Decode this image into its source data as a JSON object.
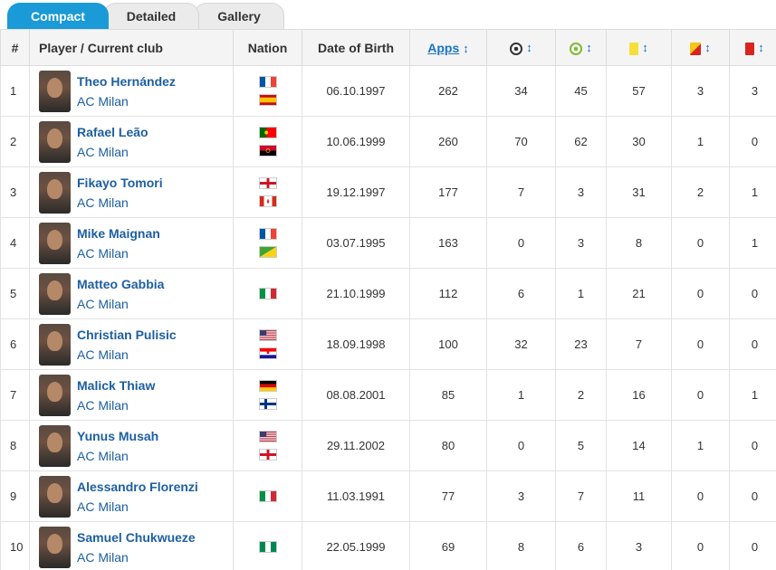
{
  "tabs": [
    "Compact",
    "Detailed",
    "Gallery"
  ],
  "headers": {
    "num": "#",
    "player": "Player / Current club",
    "nation": "Nation",
    "dob": "Date of Birth",
    "apps": "Apps",
    "sort_arrow": "↕"
  },
  "header_icons": [
    "goals-icon",
    "assists-icon",
    "yellow-card-icon",
    "second-yellow-card-icon",
    "red-card-icon"
  ],
  "colors": {
    "accent": "#1a9ad6",
    "link": "#1d5fa1"
  },
  "rows": [
    {
      "num": "1",
      "name": "Theo Hernández",
      "club": "AC Milan",
      "flags": [
        "france",
        "spain"
      ],
      "dob": "06.10.1997",
      "apps": "262",
      "goals": "34",
      "assists": "45",
      "yellow": "57",
      "second_yellow": "3",
      "red": "3"
    },
    {
      "num": "2",
      "name": "Rafael Leão",
      "club": "AC Milan",
      "flags": [
        "portugal",
        "angola"
      ],
      "dob": "10.06.1999",
      "apps": "260",
      "goals": "70",
      "assists": "62",
      "yellow": "30",
      "second_yellow": "1",
      "red": "0"
    },
    {
      "num": "3",
      "name": "Fikayo Tomori",
      "club": "AC Milan",
      "flags": [
        "england",
        "canada"
      ],
      "dob": "19.12.1997",
      "apps": "177",
      "goals": "7",
      "assists": "3",
      "yellow": "31",
      "second_yellow": "2",
      "red": "1"
    },
    {
      "num": "4",
      "name": "Mike Maignan",
      "club": "AC Milan",
      "flags": [
        "france",
        "french-guiana"
      ],
      "dob": "03.07.1995",
      "apps": "163",
      "goals": "0",
      "assists": "3",
      "yellow": "8",
      "second_yellow": "0",
      "red": "1"
    },
    {
      "num": "5",
      "name": "Matteo Gabbia",
      "club": "AC Milan",
      "flags": [
        "italy"
      ],
      "dob": "21.10.1999",
      "apps": "112",
      "goals": "6",
      "assists": "1",
      "yellow": "21",
      "second_yellow": "0",
      "red": "0"
    },
    {
      "num": "6",
      "name": "Christian Pulisic",
      "club": "AC Milan",
      "flags": [
        "usa",
        "croatia"
      ],
      "dob": "18.09.1998",
      "apps": "100",
      "goals": "32",
      "assists": "23",
      "yellow": "7",
      "second_yellow": "0",
      "red": "0"
    },
    {
      "num": "7",
      "name": "Malick Thiaw",
      "club": "AC Milan",
      "flags": [
        "germany",
        "finland"
      ],
      "dob": "08.08.2001",
      "apps": "85",
      "goals": "1",
      "assists": "2",
      "yellow": "16",
      "second_yellow": "0",
      "red": "1"
    },
    {
      "num": "8",
      "name": "Yunus Musah",
      "club": "AC Milan",
      "flags": [
        "usa",
        "england"
      ],
      "dob": "29.11.2002",
      "apps": "80",
      "goals": "0",
      "assists": "5",
      "yellow": "14",
      "second_yellow": "1",
      "red": "0"
    },
    {
      "num": "9",
      "name": "Alessandro Florenzi",
      "club": "AC Milan",
      "flags": [
        "italy"
      ],
      "dob": "11.03.1991",
      "apps": "77",
      "goals": "3",
      "assists": "7",
      "yellow": "11",
      "second_yellow": "0",
      "red": "0"
    },
    {
      "num": "10",
      "name": "Samuel Chukwueze",
      "club": "AC Milan",
      "flags": [
        "nigeria"
      ],
      "dob": "22.05.1999",
      "apps": "69",
      "goals": "8",
      "assists": "6",
      "yellow": "3",
      "second_yellow": "0",
      "red": "0"
    }
  ]
}
